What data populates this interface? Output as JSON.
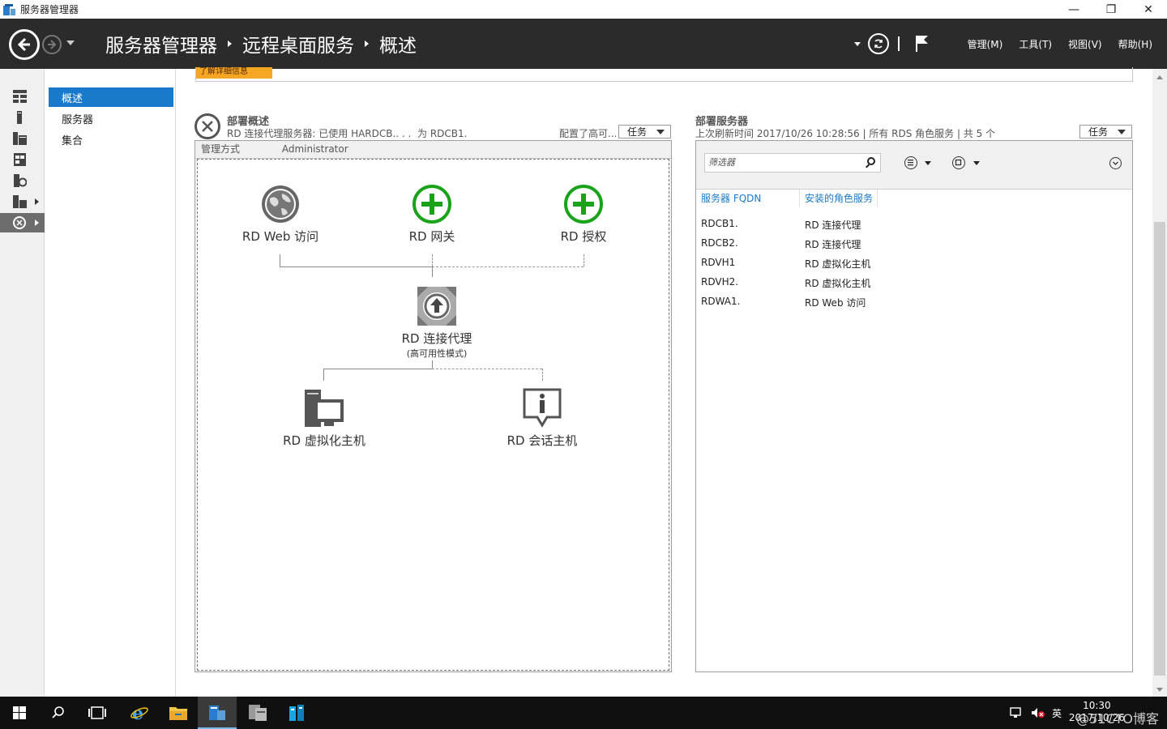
{
  "window": {
    "title": "服务器管理器",
    "controls": [
      "—",
      "❐",
      "✕"
    ]
  },
  "header": {
    "breadcrumb": [
      "服务器管理器",
      "远程桌面服务",
      "概述"
    ],
    "menu": [
      "管理(M)",
      "工具(T)",
      "视图(V)",
      "帮助(H)"
    ]
  },
  "subnav": {
    "items": [
      "概述",
      "服务器",
      "集合"
    ]
  },
  "banner": {
    "orange_tag": "了解详细信息"
  },
  "deployment": {
    "title": "部署概述",
    "subtitle": "RD 连接代理服务器: 已使用 HARDCB.‌. ‌. ‌. ‌ 为 RDCB1.",
    "subtitle_right": "配置了高可...",
    "task_label": "任务",
    "manage_label": "管理方式",
    "manage_user": "Administrator",
    "nodes": {
      "web": "RD Web 访问",
      "gateway": "RD 网关",
      "licensing": "RD 授权",
      "broker": "RD 连接代理",
      "broker_sub": "(高可用性模式)",
      "virt": "RD 虚拟化主机",
      "session": "RD 会话主机"
    }
  },
  "servers": {
    "title": "部署服务器",
    "subtitle": "上次刷新时间 2017/10/26 10:28:56 | 所有 RDS 角色服务  | 共 5 个",
    "task_label": "任务",
    "filter_placeholder": "筛选器",
    "columns": [
      "服务器 FQDN",
      "安装的角色服务"
    ],
    "rows": [
      {
        "fqdn": "RDCB1.",
        "role": "RD 连接代理"
      },
      {
        "fqdn": "RDCB2.",
        "role": "RD 连接代理"
      },
      {
        "fqdn": "RDVH1",
        "role": "RD 虚拟化主机"
      },
      {
        "fqdn": "RDVH2.",
        "role": "RD 虚拟化主机"
      },
      {
        "fqdn": "RDWA1.",
        "role": "RD Web 访问"
      }
    ]
  },
  "taskbar": {
    "time": "10:30",
    "date": "2017/10/26",
    "ime": "英",
    "watermark": "@51CTO博客"
  },
  "colors": {
    "header_bg": "#2b2b2b",
    "accent": "#1979ca",
    "orange": "#f5a623",
    "green": "#1aa31a"
  }
}
